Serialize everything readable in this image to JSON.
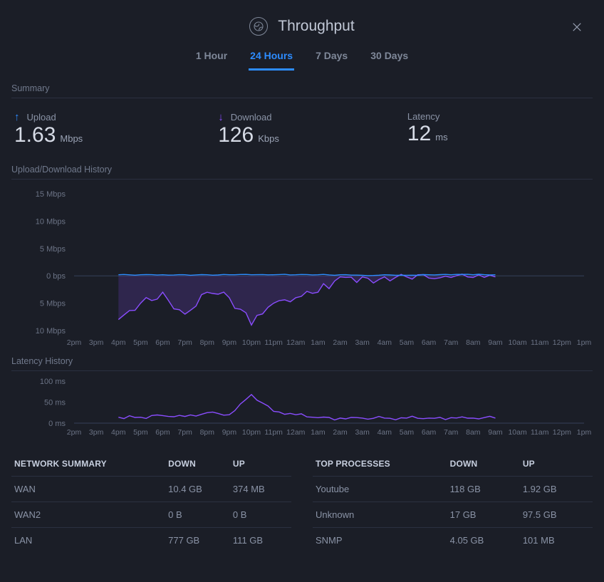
{
  "header": {
    "title": "Throughput"
  },
  "tabs": {
    "items": [
      {
        "label": "1 Hour",
        "active": false
      },
      {
        "label": "24 Hours",
        "active": true
      },
      {
        "label": "7 Days",
        "active": false
      },
      {
        "label": "30 Days",
        "active": false
      }
    ]
  },
  "sections": {
    "summary": "Summary",
    "history": "Upload/Download History",
    "latency": "Latency History"
  },
  "metrics": {
    "upload": {
      "label": "Upload",
      "value": "1.63",
      "unit": "Mbps"
    },
    "download": {
      "label": "Download",
      "value": "126",
      "unit": "Kbps"
    },
    "latency": {
      "label": "Latency",
      "value": "12",
      "unit": "ms"
    }
  },
  "network_summary": {
    "title": "NETWORK SUMMARY",
    "cols": {
      "down": "DOWN",
      "up": "UP"
    },
    "rows": [
      {
        "name": "WAN",
        "down": "10.4 GB",
        "up": "374 MB"
      },
      {
        "name": "WAN2",
        "down": "0 B",
        "up": "0 B"
      },
      {
        "name": "LAN",
        "down": "777 GB",
        "up": "111 GB"
      }
    ]
  },
  "top_processes": {
    "title": "TOP PROCESSES",
    "cols": {
      "down": "DOWN",
      "up": "UP"
    },
    "rows": [
      {
        "name": "Youtube",
        "down": "118 GB",
        "up": "1.92 GB"
      },
      {
        "name": "Unknown",
        "down": "17 GB",
        "up": "97.5 GB"
      },
      {
        "name": "SNMP",
        "down": "4.05 GB",
        "up": "101 MB"
      }
    ]
  },
  "chart_data": [
    {
      "id": "throughput_history",
      "type": "line",
      "title": "Upload/Download History",
      "x": [
        "2pm",
        "3pm",
        "4pm",
        "5pm",
        "6pm",
        "7pm",
        "8pm",
        "9pm",
        "10pm",
        "11pm",
        "12am",
        "1am",
        "2am",
        "3am",
        "4am",
        "5am",
        "6am",
        "7am",
        "8am",
        "9am",
        "10am",
        "11am",
        "12pm",
        "1pm"
      ],
      "y_ticks_up": [
        "0 bps",
        "5 Mbps",
        "10 Mbps",
        "15 Mbps"
      ],
      "y_ticks_down": [
        "5 Mbps",
        "10 Mbps"
      ],
      "series": [
        {
          "name": "Upload",
          "unit": "Mbps",
          "color": "#2d8cff",
          "values": [
            null,
            null,
            0.2,
            0.2,
            0.2,
            0.2,
            0.2,
            0.2,
            0.2,
            0.2,
            0.2,
            0.2,
            0.2,
            0.1,
            0.2,
            0.1,
            0.2,
            0.2,
            0.2,
            0.2,
            null,
            null,
            null,
            0.2
          ]
        },
        {
          "name": "Download",
          "unit": "Mbps",
          "color": "#8a4dff",
          "note": "negative direction on mirrored axis",
          "values": [
            null,
            null,
            -8,
            -5,
            -3,
            -7,
            -3,
            -4,
            -9,
            -5,
            -4,
            -3,
            -0.2,
            -0.2,
            -0.2,
            -0.2,
            -0.4,
            -0.3,
            -0.3,
            -0.2,
            null,
            null,
            null,
            -0.5
          ]
        }
      ],
      "y_range": [
        -10,
        15
      ]
    },
    {
      "id": "latency_history",
      "type": "line",
      "title": "Latency History",
      "x": [
        "2pm",
        "3pm",
        "4pm",
        "5pm",
        "6pm",
        "7pm",
        "8pm",
        "9pm",
        "10pm",
        "11pm",
        "12am",
        "1am",
        "2am",
        "3am",
        "4am",
        "5am",
        "6am",
        "7am",
        "8am",
        "9am",
        "10am",
        "11am",
        "12pm",
        "1pm"
      ],
      "series": [
        {
          "name": "Latency",
          "unit": "ms",
          "color": "#8a4dff",
          "values": [
            null,
            null,
            14,
            14,
            18,
            16,
            25,
            20,
            68,
            28,
            20,
            13,
            12,
            12,
            12,
            12,
            12,
            13,
            12,
            12,
            null,
            null,
            null,
            13
          ]
        }
      ],
      "y_ticks": [
        "0 ms",
        "50 ms",
        "100 ms"
      ],
      "y_range": [
        0,
        100
      ]
    }
  ]
}
